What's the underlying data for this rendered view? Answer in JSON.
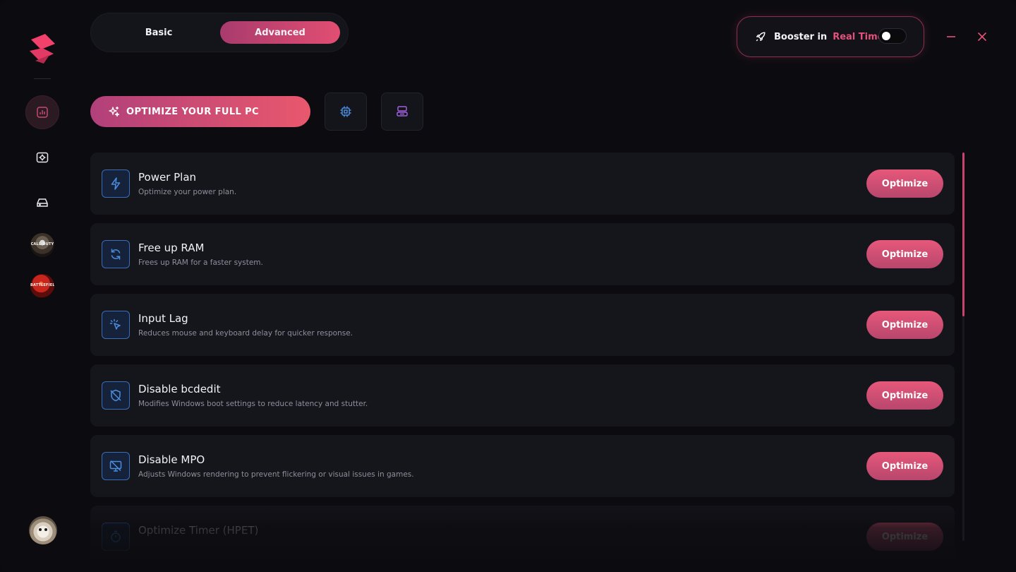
{
  "tabs": {
    "basic": "Basic",
    "advanced": "Advanced",
    "active": "advanced"
  },
  "booster": {
    "label": "Booster in",
    "accent": "Real Time",
    "enabled": false
  },
  "actions": {
    "optimize_full": "OPTIMIZE YOUR FULL PC"
  },
  "games": {
    "cod_label": "CALL·DUTY",
    "bf_label": "BATTLEFIELD"
  },
  "items": [
    {
      "title": "Power Plan",
      "desc": "Optimize your power plan.",
      "button": "Optimize",
      "icon": "lightning-icon"
    },
    {
      "title": "Free up RAM",
      "desc": "Frees up RAM for a faster system.",
      "button": "Optimize",
      "icon": "refresh-icon"
    },
    {
      "title": "Input Lag",
      "desc": "Reduces mouse and keyboard delay for quicker response.",
      "button": "Optimize",
      "icon": "cursor-click-icon"
    },
    {
      "title": "Disable bcdedit",
      "desc": "Modifies Windows boot settings to reduce latency and stutter.",
      "button": "Optimize",
      "icon": "shield-off-icon"
    },
    {
      "title": "Disable MPO",
      "desc": "Adjusts Windows rendering to prevent flickering or visual issues in games.",
      "button": "Optimize",
      "icon": "monitor-off-icon"
    },
    {
      "title": "Optimize Timer (HPET)",
      "desc": "",
      "button": "Optimize",
      "icon": "timer-icon"
    }
  ],
  "colors": {
    "accent": "#e2527a",
    "accent_dark": "#a83b6d",
    "icon_blue": "#4a8de0"
  }
}
